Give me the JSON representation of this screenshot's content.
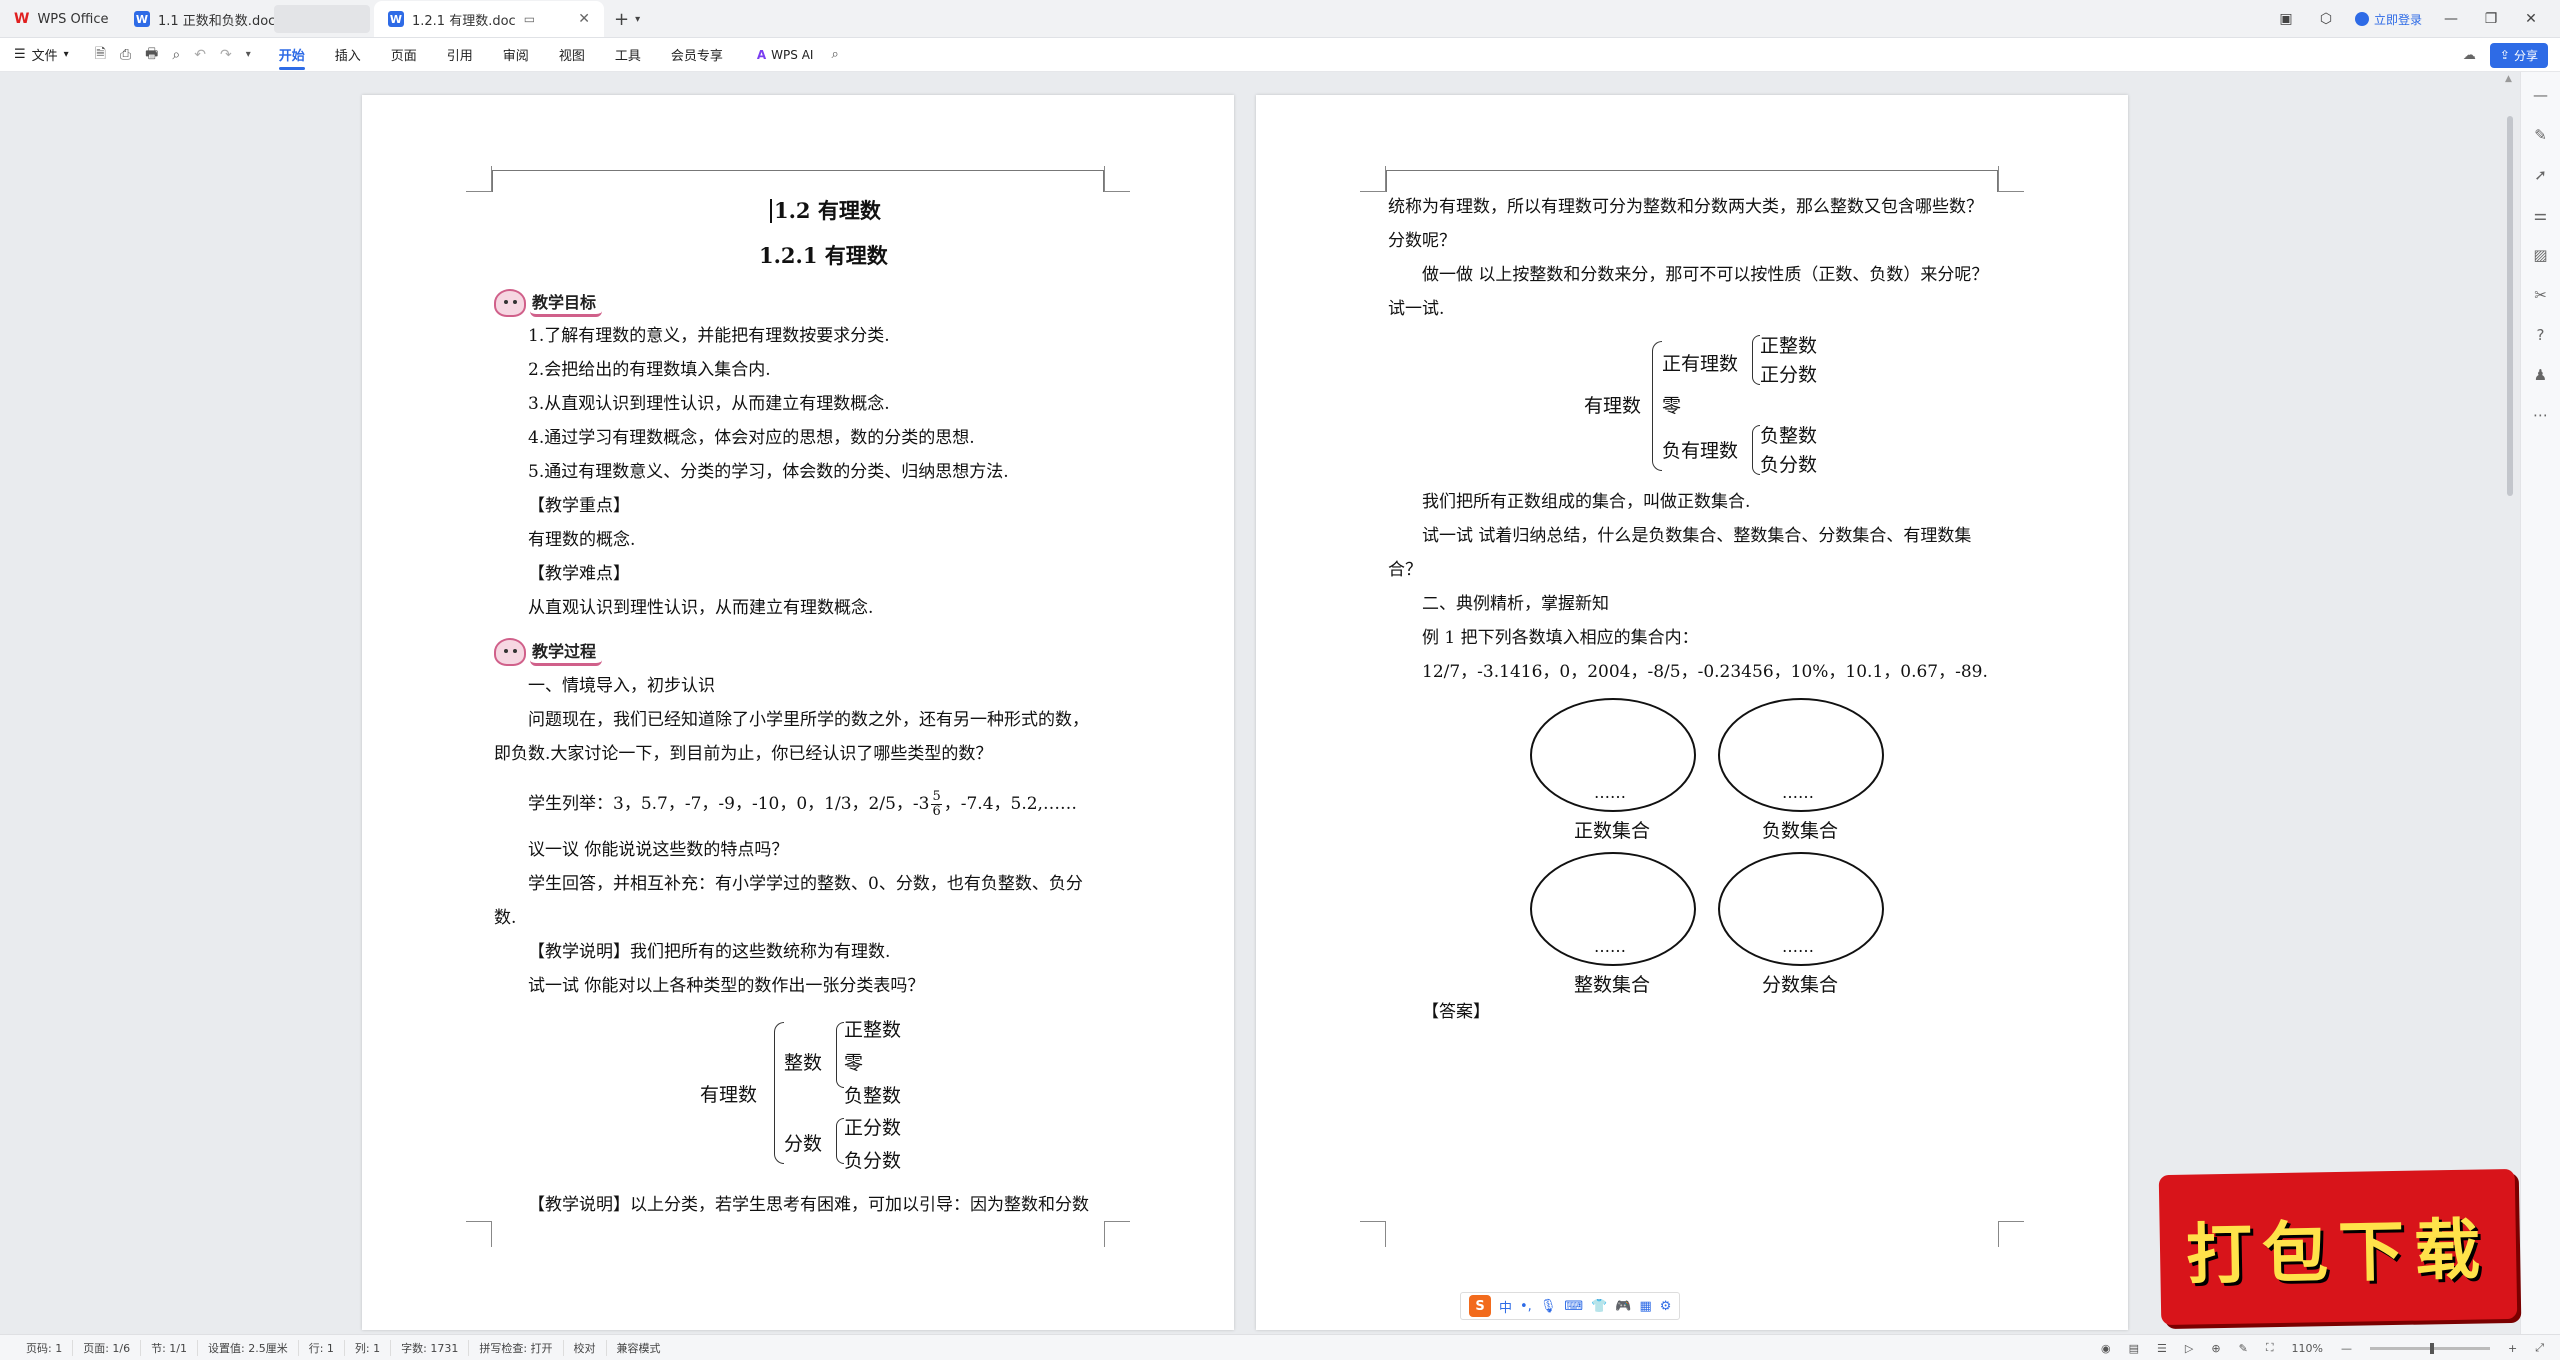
{
  "tabs": {
    "home": "WPS Office",
    "doc1": "1.1 正数和负数.doc",
    "active": "1.2.1 有理数.doc"
  },
  "title_right": {
    "login": "立即登录"
  },
  "menubar": {
    "file": "文件",
    "menus": [
      "开始",
      "插入",
      "页面",
      "引用",
      "审阅",
      "视图",
      "工具",
      "会员专享"
    ],
    "active_menu": "开始",
    "wps_ai": "WPS AI",
    "share": "分享"
  },
  "page1": {
    "title": "1.2 有理数",
    "subtitle": "1.2.1 有理数",
    "banner1": "教学目标",
    "goals": [
      "1.了解有理数的意义，并能把有理数按要求分类.",
      "2.会把给出的有理数填入集合内.",
      "3.从直观认识到理性认识，从而建立有理数概念.",
      "4.通过学习有理数概念，体会对应的思想，数的分类的思想.",
      "5.通过有理数意义、分类的学习，体会数的分类、归纳思想方法."
    ],
    "key_label": "【教学重点】",
    "key_text": "有理数的概念.",
    "diff_label": "【教学难点】",
    "diff_text": "从直观认识到理性认识，从而建立有理数概念.",
    "banner2": "教学过程",
    "s1": "一、情境导入，初步认识",
    "p1a": "问题现在，我们已经知道除了小学里所学的数之外，还有另一种形式的数，",
    "p1b": "即负数.大家讨论一下，到目前为止，你已经认识了哪些类型的数？",
    "list_a": "学生列举：3，5.7，-7，-9，-10，0，1/3，2/5，-3",
    "frac_num": "5",
    "frac_den": "6",
    "list_b": "，-7.4，5.2,……",
    "p2": "议一议  你能说说这些数的特点吗？",
    "p3a": "学生回答，并相互补充：有小学学过的整数、0、分数，也有负整数、负分",
    "p3b": "数.",
    "p4": "【教学说明】我们把所有的这些数统称为有理数.",
    "p5": "试一试  你能对以上各种类型的数作出一张分类表吗？",
    "tree": {
      "root": "有理数",
      "int": "整数",
      "frac": "分数",
      "posint": "正整数",
      "zero": "零",
      "negint": "负整数",
      "posfrac": "正分数",
      "negfrac": "负分数"
    },
    "p6": "【教学说明】以上分类，若学生思考有困难，可加以引导：因为整数和分数"
  },
  "page2": {
    "p1": "统称为有理数，所以有理数可分为整数和分数两大类，那么整数又包含哪些数？",
    "p2": "分数呢？",
    "p3": "做一做  以上按整数和分数来分，那可不可以按性质（正数、负数）来分呢？",
    "p4": "试一试.",
    "tree": {
      "root": "有理数",
      "pos": "正有理数",
      "zero": "零",
      "neg": "负有理数",
      "posint": "正整数",
      "posfrac": "正分数",
      "negint": "负整数",
      "negfrac": "负分数"
    },
    "p5": "我们把所有正数组成的集合，叫做正数集合.",
    "p6": "试一试  试着归纳总结，什么是负数集合、整数集合、分数集合、有理数集",
    "p7": "合？",
    "p8": "二、典例精析，掌握新知",
    "p9": "例 1  把下列各数填入相应的集合内：",
    "p10": "12/7，-3.1416，0，2004，-8/5，-0.23456，10%，10.1，0.67，-89.",
    "dots": "……",
    "sets": [
      "正数集合",
      "负数集合",
      "整数集合",
      "分数集合"
    ],
    "answer": "【答案】"
  },
  "statusbar": {
    "page": "页码: 1",
    "pages": "页面: 1/6",
    "section": "节: 1/1",
    "setting": "设置值: 2.5厘米",
    "row": "行: 1",
    "col": "列: 1",
    "words": "字数: 1731",
    "spell": "拼写检查: 打开",
    "proof": "校对",
    "compat": "兼容模式",
    "zoom": "110%"
  },
  "ime": {
    "label": "中"
  },
  "badge": {
    "text": "打包下载"
  },
  "colors": {
    "accent": "#2e6be6",
    "badge": "#d8141a",
    "badge_text": "#ffe24a"
  }
}
